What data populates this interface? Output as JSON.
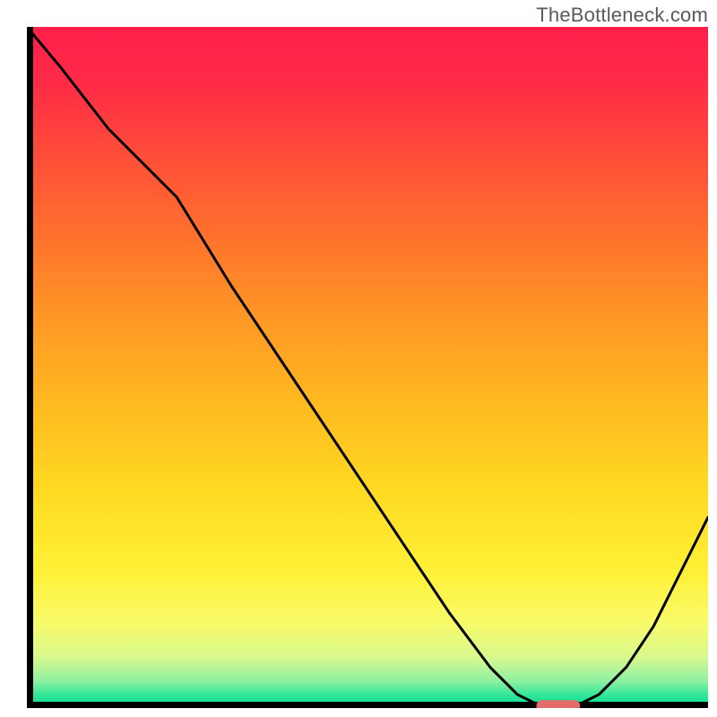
{
  "header": {
    "watermark": "TheBottleneck.com"
  },
  "chart_data": {
    "type": "line",
    "title": "",
    "xlabel": "",
    "ylabel": "",
    "xlim": [
      0,
      100
    ],
    "ylim": [
      0,
      100
    ],
    "grid": false,
    "legend": false,
    "series": [
      {
        "name": "curve",
        "x": [
          0,
          5,
          12,
          22,
          30,
          38,
          46,
          54,
          62,
          68,
          72,
          76,
          80,
          84,
          88,
          92,
          96,
          100
        ],
        "y": [
          100,
          94,
          85,
          75,
          62,
          50,
          38,
          26,
          14,
          6,
          2,
          0,
          0,
          2,
          6,
          12,
          20,
          28
        ]
      }
    ],
    "marker": {
      "x_center": 78,
      "x_halfwidth": 3.2,
      "y": 0.3,
      "color": "#e26a6a"
    },
    "gradient_stops": [
      {
        "offset": 0.0,
        "color": "#ff1f4b"
      },
      {
        "offset": 0.08,
        "color": "#ff2a47"
      },
      {
        "offset": 0.18,
        "color": "#ff4a3a"
      },
      {
        "offset": 0.3,
        "color": "#ff6f2e"
      },
      {
        "offset": 0.42,
        "color": "#ff9526"
      },
      {
        "offset": 0.55,
        "color": "#ffb820"
      },
      {
        "offset": 0.68,
        "color": "#ffd922"
      },
      {
        "offset": 0.8,
        "color": "#fff035"
      },
      {
        "offset": 0.88,
        "color": "#f8fb6a"
      },
      {
        "offset": 0.93,
        "color": "#d7f98e"
      },
      {
        "offset": 0.965,
        "color": "#8ef0a2"
      },
      {
        "offset": 0.985,
        "color": "#33e79a"
      },
      {
        "offset": 1.0,
        "color": "#0fdc90"
      }
    ],
    "axis": {
      "color": "#000000",
      "width": 7
    },
    "curve_style": {
      "color": "#000000",
      "width": 3
    }
  }
}
